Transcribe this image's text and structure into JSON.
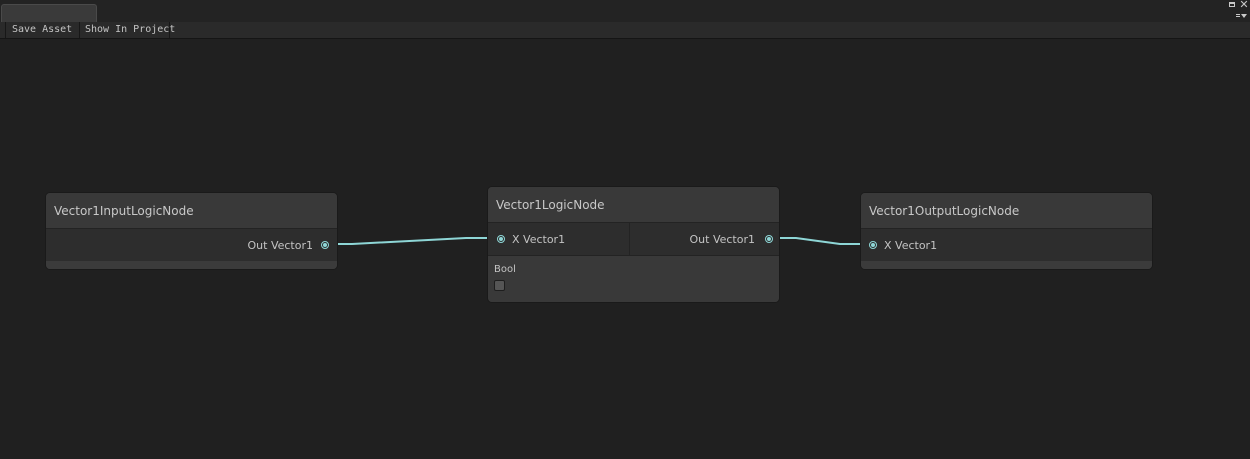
{
  "toolbar": {
    "save_asset": "Save Asset",
    "show_in_project": "Show In Project"
  },
  "nodes": {
    "input": {
      "title": "Vector1InputLogicNode",
      "output_port": "Out Vector1"
    },
    "logic": {
      "title": "Vector1LogicNode",
      "input_port": "X Vector1",
      "output_port": "Out Vector1",
      "field_label": "Bool",
      "field_checked": false
    },
    "output": {
      "title": "Vector1OutputLogicNode",
      "input_port": "X Vector1"
    }
  },
  "colors": {
    "edge": "#8ed6d6",
    "background": "#202020",
    "node": "#393939"
  },
  "icons": [
    "maximize-icon",
    "close-icon",
    "menu-icon",
    "port-icon",
    "checkbox-icon"
  ]
}
